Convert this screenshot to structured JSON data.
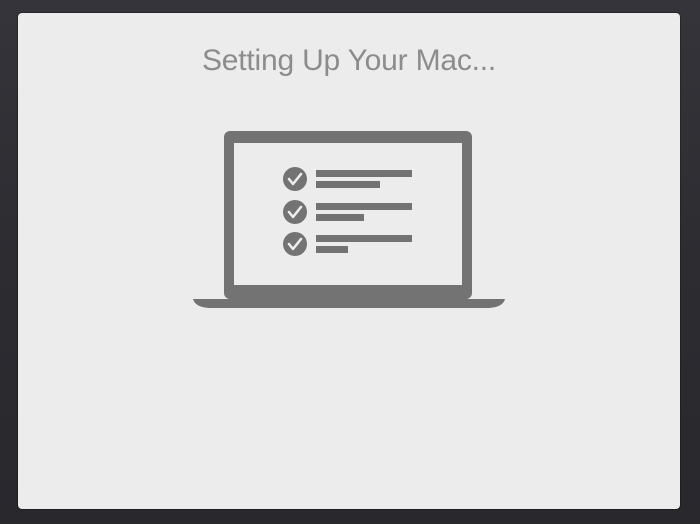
{
  "window": {
    "title": "Setting Up Your Mac..."
  },
  "illustration": {
    "icon": "laptop-checklist-icon",
    "checklist_rows": 3,
    "all_checked": true
  },
  "colors": {
    "background": "#2b2b30",
    "panel": "#ececec",
    "title_text": "#8c8c8c",
    "illustration": "#737373"
  }
}
